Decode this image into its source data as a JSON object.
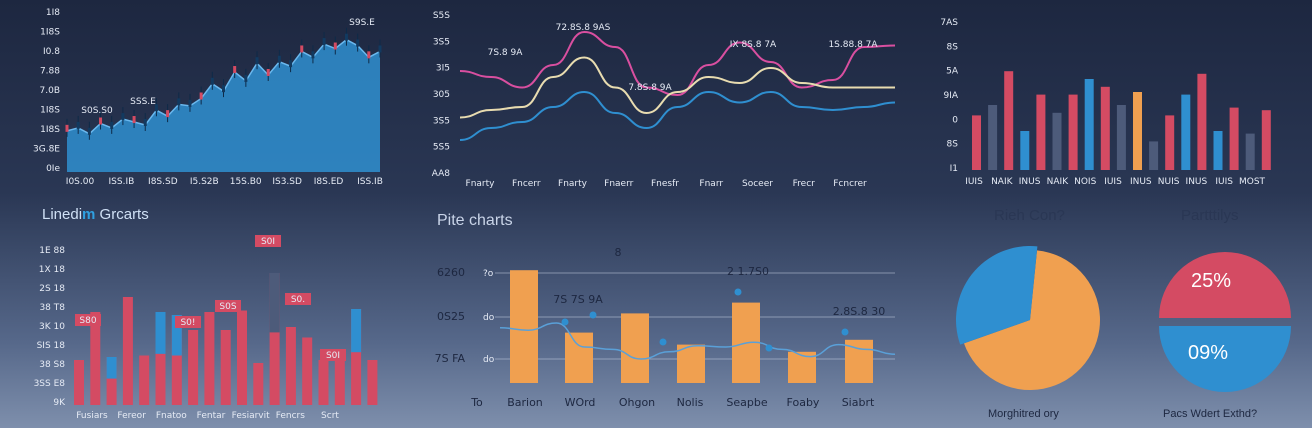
{
  "colors": {
    "blue": "#2f8fd0",
    "red": "#d44b63",
    "slate": "#4d5b7a",
    "orange": "#f0a050",
    "pink": "#d94fa0",
    "cream": "#e8dcb0"
  },
  "brand": {
    "prefix": "Linedi",
    "highlight": "m",
    "suffix": " Grcarts"
  },
  "chart_data": [
    {
      "type": "area",
      "ytick_labels": [
        "1I8",
        "1I8S",
        "I0.8",
        "7.88",
        "7.0B",
        "1I8S",
        "1I8S",
        "3G.8E",
        "0Ie"
      ],
      "xtick_labels": [
        "I0S.00",
        "ISS.IB",
        "I8S.SD",
        "I5.S2B",
        "15S.B0",
        "IS3.SD",
        "I8S.ED",
        "ISS.IB"
      ],
      "annotations": [
        "S0S.S0",
        "SSS.E",
        "S9S.E"
      ],
      "values": [
        0.28,
        0.3,
        0.26,
        0.33,
        0.3,
        0.36,
        0.34,
        0.32,
        0.42,
        0.38,
        0.46,
        0.45,
        0.5,
        0.6,
        0.55,
        0.68,
        0.62,
        0.74,
        0.66,
        0.75,
        0.72,
        0.82,
        0.78,
        0.87,
        0.84,
        0.9,
        0.86,
        0.78,
        0.82
      ],
      "ylim": [
        0,
        1
      ]
    },
    {
      "type": "line",
      "ytick_labels": [
        "S5S",
        "3S5",
        "3I5",
        "305",
        "3S5",
        "5S5",
        "AA8"
      ],
      "xtick_labels": [
        "Fnarty",
        "Fncerr",
        "Fnarty",
        "Fnaerr",
        "Fnesfr",
        "Fnarr",
        "Soceer",
        "Frecr",
        "Fcncrer"
      ],
      "annotations": [
        "72.8S.8 9AS",
        "7S.8 9A",
        "7.8S.8 9A",
        "IX 8S.8 7A",
        "1S.88.8 7A"
      ],
      "series": [
        {
          "values": [
            0.66,
            0.62,
            0.55,
            0.7,
            0.92,
            0.82,
            0.55,
            0.5,
            0.7,
            0.85,
            0.72,
            0.55,
            0.6,
            0.82,
            0.83
          ]
        },
        {
          "values": [
            0.35,
            0.4,
            0.42,
            0.62,
            0.75,
            0.55,
            0.38,
            0.52,
            0.62,
            0.58,
            0.68,
            0.58,
            0.55,
            0.55,
            0.55
          ]
        },
        {
          "values": [
            0.2,
            0.28,
            0.32,
            0.42,
            0.52,
            0.38,
            0.28,
            0.42,
            0.52,
            0.45,
            0.52,
            0.42,
            0.4,
            0.42,
            0.45
          ]
        }
      ],
      "ylim": [
        0,
        1
      ]
    },
    {
      "type": "bar",
      "ytick_labels": [
        "7AS",
        "8S",
        "5A",
        "9IA",
        "0",
        "8S",
        "I1"
      ],
      "xtick_labels": [
        "IUIS",
        "NAIK",
        "INUS",
        "NAIK",
        "NOIS",
        "IUIS",
        "INUS",
        "NUIS",
        "INUS",
        "IUIS",
        "MOST"
      ],
      "values": [
        0.42,
        0.5,
        0.76,
        0.3,
        0.58,
        0.44,
        0.58,
        0.7,
        0.64,
        0.5,
        0.6,
        0.22,
        0.42,
        0.58,
        0.74,
        0.3,
        0.48,
        0.28,
        0.46
      ],
      "colors": [
        "red",
        "slate",
        "red",
        "blue",
        "red",
        "slate",
        "red",
        "blue",
        "red",
        "slate",
        "orange",
        "slate",
        "red",
        "blue",
        "red",
        "blue",
        "red",
        "slate",
        "red"
      ],
      "ylim": [
        0,
        1
      ]
    },
    {
      "type": "bar",
      "ytick_labels": [
        "1E 88",
        "1X 18",
        "2S 18",
        "38 T8",
        "3K 10",
        "SIS 18",
        "38 S8",
        "3SS E8",
        "9K"
      ],
      "xtick_labels": [
        "Fusiars",
        "Fereor",
        "Fnatoo",
        "Fentar",
        "Fesiarvit",
        "Fencrs",
        "Scrt"
      ],
      "annotations": [
        "S80",
        "S0!",
        "S0S",
        "S0I",
        "S0.",
        "S0I"
      ],
      "values": [
        0.3,
        0.62,
        0.32,
        0.72,
        0.33,
        0.62,
        0.6,
        0.5,
        0.62,
        0.5,
        0.63,
        0.28,
        0.88,
        0.52,
        0.45,
        0.3,
        0.36,
        0.64,
        0.3
      ],
      "stack": [
        0,
        0,
        0.45,
        0,
        0,
        0.4,
        0.88,
        0,
        0,
        0,
        0,
        0,
        0.5,
        0,
        0,
        0,
        0,
        0.8,
        0
      ],
      "ylim": [
        0,
        1
      ]
    },
    {
      "type": "bar",
      "title": "Pite charts",
      "ytick_labels": [
        "6260",
        "0S25",
        "7S FA"
      ],
      "ytick_right": [
        "?o",
        "do",
        "do"
      ],
      "xtick_labels": [
        "To",
        "Barion",
        "WOrd",
        "Ohgon",
        "Nolis",
        "Seapbe",
        "Foaby",
        "Siabrt"
      ],
      "annotations": [
        "7S 7S 9A",
        "2 1.7S0",
        "2.8S.8 30",
        "8"
      ],
      "values": [
        0.94,
        0.42,
        0.58,
        0.32,
        0.67,
        0.26,
        0.36
      ],
      "line": [
        0.46,
        0.44,
        0.5,
        0.3,
        0.28,
        0.2,
        0.26,
        0.31,
        0.3,
        0.34,
        0.28,
        0.22,
        0.32,
        0.28,
        0.24
      ],
      "ylim": [
        0,
        1
      ]
    },
    {
      "type": "pie",
      "title": "Rieh Con?",
      "caption": "Morghitred ory",
      "values": [
        68,
        32
      ]
    },
    {
      "type": "pie",
      "title": "Partttilys",
      "caption": "Pacs Wdert Exthd?",
      "labels": [
        "25%",
        "09%"
      ],
      "values": [
        25,
        9
      ]
    }
  ]
}
